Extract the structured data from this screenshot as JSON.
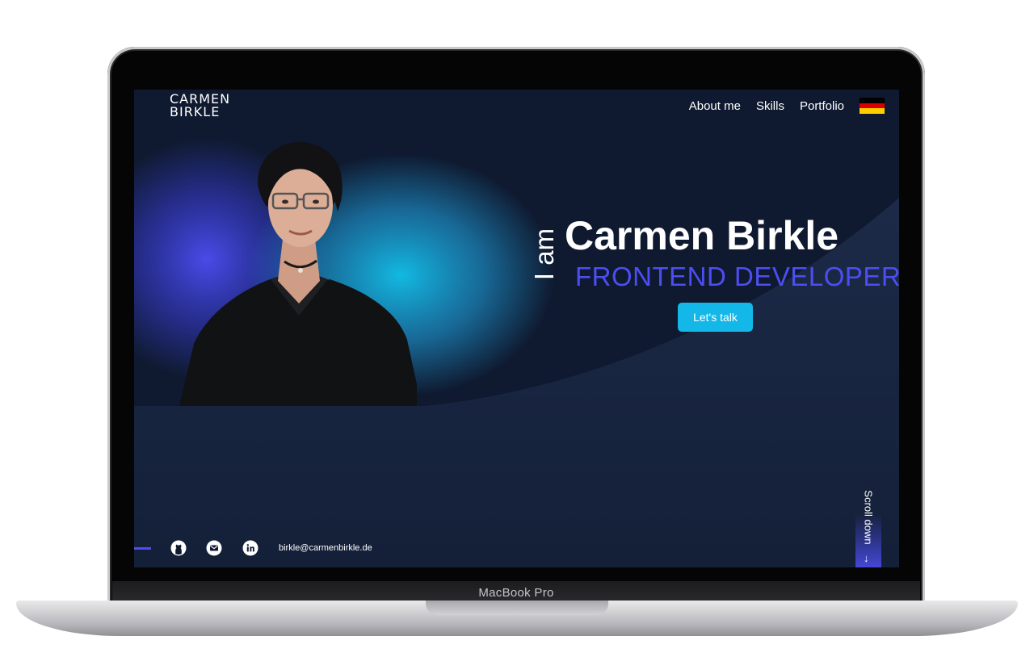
{
  "device": {
    "model_label": "MacBook Pro"
  },
  "site": {
    "logo": {
      "line1": "CARMEN",
      "line2": "BIRKLE"
    },
    "nav": [
      {
        "label": "About me"
      },
      {
        "label": "Skills"
      },
      {
        "label": "Portfolio"
      }
    ],
    "language_flag": {
      "icon": "german-flag-icon",
      "colors": [
        "#000000",
        "#dd0000",
        "#ffce00"
      ]
    },
    "hero": {
      "intro": "I am",
      "name": "Carmen Birkle",
      "role": "FRONTEND DEVELOPER",
      "cta_label": "Let's talk"
    },
    "footer": {
      "social": [
        {
          "icon": "github-icon"
        },
        {
          "icon": "email-icon"
        },
        {
          "icon": "linkedin-icon"
        }
      ],
      "email": "birkle@carmenbirkle.de"
    },
    "scroll": {
      "label": "Scroll down",
      "arrow": "↓"
    },
    "colors": {
      "background": "#0f1a30",
      "curve": "#1a2744",
      "accent": "#4c4ef2",
      "cta": "#13b8e8",
      "glow": "#12c2ea"
    }
  }
}
